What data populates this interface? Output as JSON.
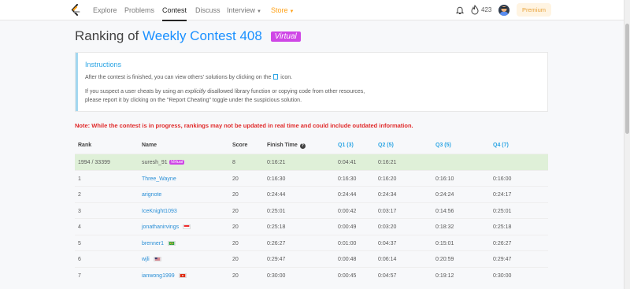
{
  "nav": {
    "explore": "Explore",
    "problems": "Problems",
    "contest": "Contest",
    "discuss": "Discuss",
    "interview": "Interview",
    "store": "Store",
    "fire_count": "423",
    "premium": "Premium",
    "icons": {
      "logo": "leetcode-logo",
      "bell": "bell-icon",
      "fire": "fire-icon",
      "avatar": "avatar"
    }
  },
  "page": {
    "title_prefix": "Ranking of",
    "title_contest": "Weekly Contest 408",
    "virtual_badge": "Virtual"
  },
  "instructions": {
    "title": "Instructions",
    "line1_before": "After the contest is finished, you can view others' solutions by clicking on the",
    "line1_after": "icon.",
    "line2_before": "If you suspect a user cheats by using an",
    "line2_em": "explicitly",
    "line2_after": "disallowed library function or copying code from other resources,",
    "line3": "please report it by clicking on the \"Report Cheating\" toggle under the suspicious solution."
  },
  "note": "Note: While the contest is in progress, rankings may not be updated in real time and could include outdated information.",
  "table": {
    "headers": {
      "rank": "Rank",
      "name": "Name",
      "score": "Score",
      "finish": "Finish Time",
      "q1": "Q1 (3)",
      "q2": "Q2 (5)",
      "q3": "Q3 (5)",
      "q4": "Q4 (7)"
    },
    "rows": [
      {
        "rank": "1994 / 33399",
        "name": "suresh_91",
        "badge": "Virtual",
        "flag": "",
        "score": "8",
        "finish": "0:16:21",
        "q1": "0:04:41",
        "q2": "0:16:21",
        "q3": "",
        "q4": ""
      },
      {
        "rank": "1",
        "name": "Three_Wayne",
        "badge": "",
        "flag": "",
        "score": "20",
        "finish": "0:16:30",
        "q1": "0:16:30",
        "q2": "0:16:20",
        "q3": "0:16:10",
        "q4": "0:16:00"
      },
      {
        "rank": "2",
        "name": "arignote",
        "badge": "",
        "flag": "",
        "score": "20",
        "finish": "0:24:44",
        "q1": "0:24:44",
        "q2": "0:24:34",
        "q3": "0:24:24",
        "q4": "0:24:17"
      },
      {
        "rank": "3",
        "name": "IceKnight1093",
        "badge": "",
        "flag": "",
        "score": "20",
        "finish": "0:25:01",
        "q1": "0:00:42",
        "q2": "0:03:17",
        "q3": "0:14:56",
        "q4": "0:25:01"
      },
      {
        "rank": "4",
        "name": "jonathanirvings",
        "badge": "",
        "flag": "singapore",
        "score": "20",
        "finish": "0:25:18",
        "q1": "0:00:49",
        "q2": "0:03:20",
        "q3": "0:18:32",
        "q4": "0:25:18"
      },
      {
        "rank": "5",
        "name": "brenner1",
        "badge": "",
        "flag": "brazil",
        "score": "20",
        "finish": "0:26:27",
        "q1": "0:01:00",
        "q2": "0:04:37",
        "q3": "0:15:01",
        "q4": "0:26:27"
      },
      {
        "rank": "6",
        "name": "wjli",
        "badge": "",
        "flag": "usa",
        "score": "20",
        "finish": "0:29:47",
        "q1": "0:00:48",
        "q2": "0:06:14",
        "q3": "0:20:59",
        "q4": "0:29:47"
      },
      {
        "rank": "7",
        "name": "ianwong1999",
        "badge": "",
        "flag": "hong-kong",
        "score": "20",
        "finish": "0:30:00",
        "q1": "0:00:45",
        "q2": "0:04:57",
        "q3": "0:19:12",
        "q4": "0:30:00"
      }
    ]
  }
}
